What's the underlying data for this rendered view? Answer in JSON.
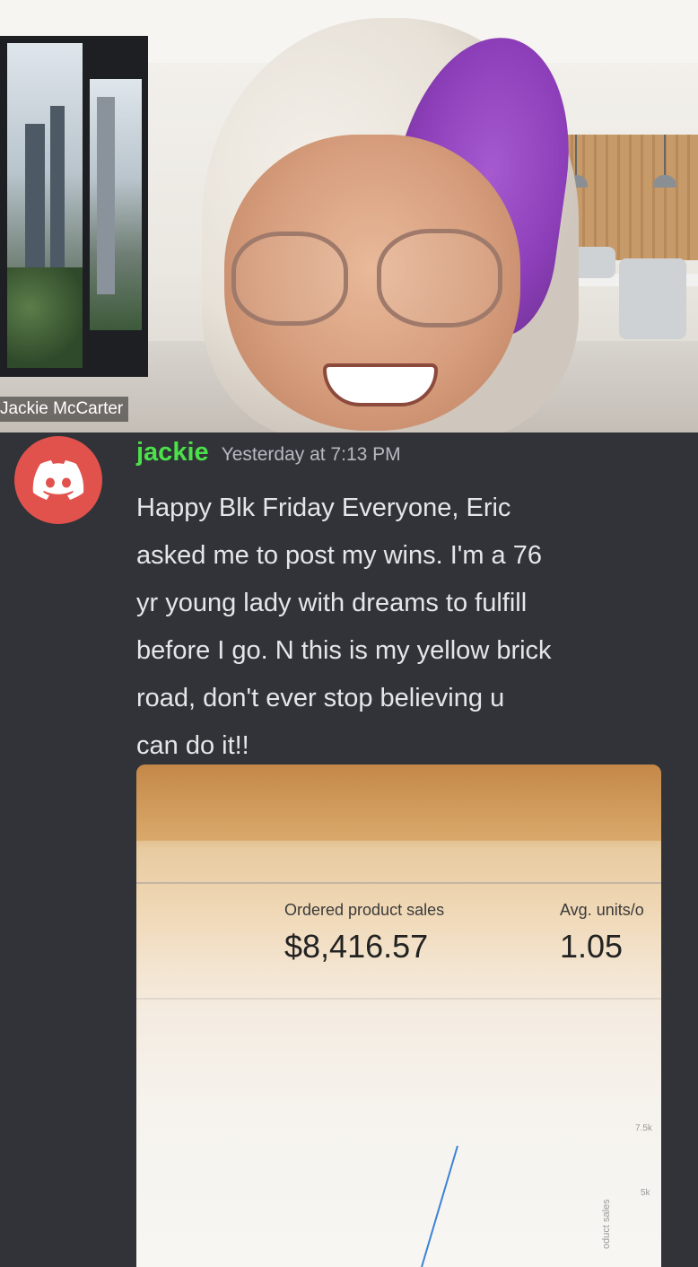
{
  "video": {
    "participant_name": "Jackie McCarter"
  },
  "message": {
    "author": "jackie",
    "author_color": "#4ce04a",
    "timestamp": "Yesterday at 7:13 PM",
    "avatar_icon": "discord-logo-icon",
    "avatar_color": "#e2524d",
    "lines": [
      "Happy Blk Friday Everyone,  Eric",
      "asked me to post my wins.  I'm a 76",
      "yr young lady with dreams to fulfill",
      "before I go. N this is my yellow brick",
      "road, don't ever stop believing  u",
      "can do it!!"
    ]
  },
  "attachment": {
    "metrics": [
      {
        "label": "Ordered product sales",
        "value": "$8,416.57"
      },
      {
        "label": "Avg. units/o",
        "value": "1.05"
      }
    ],
    "chart": {
      "ticks": [
        "7.5k",
        "5k"
      ],
      "axis_label": "oduct sales",
      "line_color": "#3b82d6"
    }
  }
}
